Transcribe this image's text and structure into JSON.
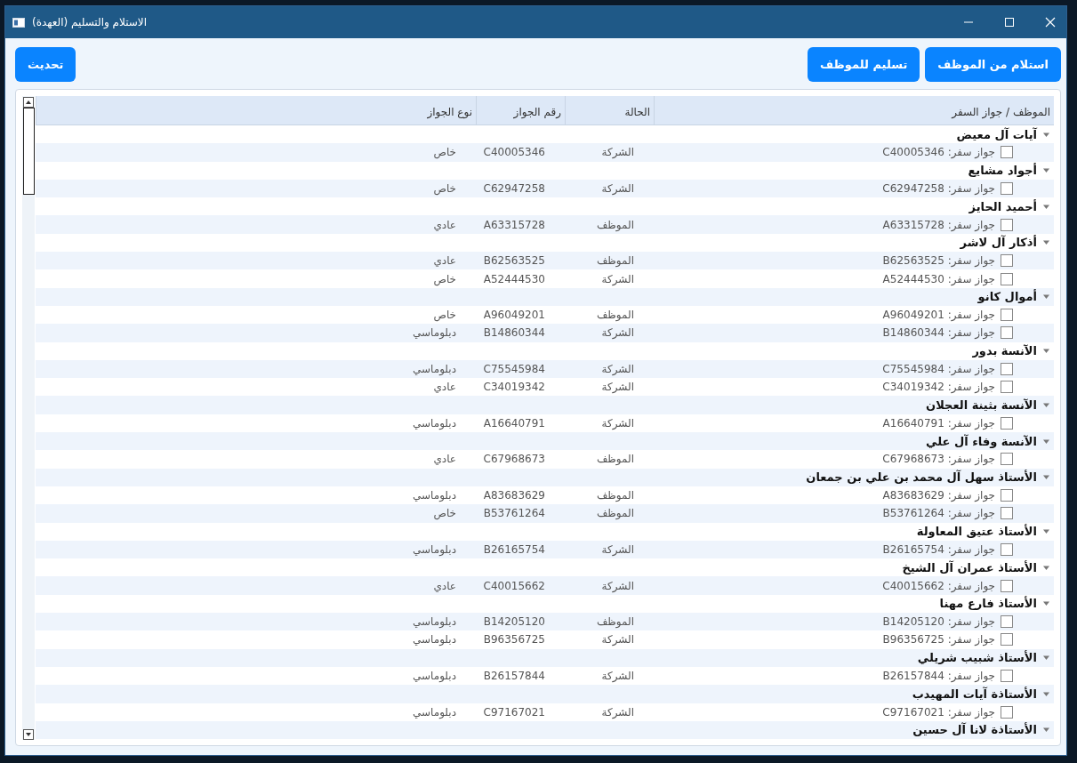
{
  "window": {
    "title": "الاستلام والتسليم (العهدة)"
  },
  "toolbar": {
    "refresh": "تحديث",
    "actions": [
      "استلام من الموظف",
      "تسليم للموظف"
    ]
  },
  "table": {
    "columns": [
      "الموظف / جواز السفر",
      "الحالة",
      "رقم الجواز",
      "نوع الجواز"
    ],
    "groups": [
      {
        "name": "آيات آل معيض",
        "expanded": true,
        "children": [
          {
            "label": "جواز سفر: C40005346",
            "checked": false,
            "status": "الشركة",
            "passport_no": "C40005346",
            "passport_type": "خاص"
          }
        ]
      },
      {
        "name": "أجواد مشايع",
        "expanded": true,
        "children": [
          {
            "label": "جواز سفر: C62947258",
            "checked": false,
            "status": "الشركة",
            "passport_no": "C62947258",
            "passport_type": "خاص"
          }
        ]
      },
      {
        "name": "أحميد الحايز",
        "expanded": true,
        "children": [
          {
            "label": "جواز سفر: A63315728",
            "checked": false,
            "status": "الموظف",
            "passport_no": "A63315728",
            "passport_type": "عادي"
          }
        ]
      },
      {
        "name": "أذكار آل لاشر",
        "expanded": true,
        "children": [
          {
            "label": "جواز سفر: B62563525",
            "checked": false,
            "status": "الموظف",
            "passport_no": "B62563525",
            "passport_type": "عادي"
          },
          {
            "label": "جواز سفر: A52444530",
            "checked": false,
            "status": "الشركة",
            "passport_no": "A52444530",
            "passport_type": "خاص"
          }
        ]
      },
      {
        "name": "أموال كانو",
        "expanded": true,
        "children": [
          {
            "label": "جواز سفر: A96049201",
            "checked": false,
            "status": "الموظف",
            "passport_no": "A96049201",
            "passport_type": "خاص"
          },
          {
            "label": "جواز سفر: B14860344",
            "checked": false,
            "status": "الشركة",
            "passport_no": "B14860344",
            "passport_type": "دبلوماسي"
          }
        ]
      },
      {
        "name": "الآنسة بدور",
        "expanded": true,
        "children": [
          {
            "label": "جواز سفر: C75545984",
            "checked": false,
            "status": "الشركة",
            "passport_no": "C75545984",
            "passport_type": "دبلوماسي"
          },
          {
            "label": "جواز سفر: C34019342",
            "checked": false,
            "status": "الشركة",
            "passport_no": "C34019342",
            "passport_type": "عادي"
          }
        ]
      },
      {
        "name": "الآنسة بثينة العجلان",
        "expanded": true,
        "children": [
          {
            "label": "جواز سفر: A16640791",
            "checked": false,
            "status": "الشركة",
            "passport_no": "A16640791",
            "passport_type": "دبلوماسي"
          }
        ]
      },
      {
        "name": "الآنسة وفاء آل علي",
        "expanded": true,
        "children": [
          {
            "label": "جواز سفر: C67968673",
            "checked": false,
            "status": "الموظف",
            "passport_no": "C67968673",
            "passport_type": "عادي"
          }
        ]
      },
      {
        "name": "الأستاذ سهل آل محمد بن علي بن جمعان",
        "expanded": true,
        "children": [
          {
            "label": "جواز سفر: A83683629",
            "checked": false,
            "status": "الموظف",
            "passport_no": "A83683629",
            "passport_type": "دبلوماسي"
          },
          {
            "label": "جواز سفر: B53761264",
            "checked": false,
            "status": "الموظف",
            "passport_no": "B53761264",
            "passport_type": "خاص"
          }
        ]
      },
      {
        "name": "الأستاذ عتيق المعاولة",
        "expanded": true,
        "children": [
          {
            "label": "جواز سفر: B26165754",
            "checked": false,
            "status": "الشركة",
            "passport_no": "B26165754",
            "passport_type": "دبلوماسي"
          }
        ]
      },
      {
        "name": "الأستاذ عمران آل الشيخ",
        "expanded": true,
        "children": [
          {
            "label": "جواز سفر: C40015662",
            "checked": false,
            "status": "الشركة",
            "passport_no": "C40015662",
            "passport_type": "عادي"
          }
        ]
      },
      {
        "name": "الأستاذ فارع مهنا",
        "expanded": true,
        "children": [
          {
            "label": "جواز سفر: B14205120",
            "checked": false,
            "status": "الموظف",
            "passport_no": "B14205120",
            "passport_type": "دبلوماسي"
          },
          {
            "label": "جواز سفر: B96356725",
            "checked": false,
            "status": "الشركة",
            "passport_no": "B96356725",
            "passport_type": "دبلوماسي"
          }
        ]
      },
      {
        "name": "الأستاذ شبيب شريلي",
        "expanded": true,
        "children": [
          {
            "label": "جواز سفر: B26157844",
            "checked": false,
            "status": "الشركة",
            "passport_no": "B26157844",
            "passport_type": "دبلوماسي"
          }
        ]
      },
      {
        "name": "الأستاذة آيات المهيدب",
        "expanded": true,
        "children": [
          {
            "label": "جواز سفر: C97167021",
            "checked": false,
            "status": "الشركة",
            "passport_no": "C97167021",
            "passport_type": "دبلوماسي"
          }
        ]
      },
      {
        "name": "الأستاذة لانا آل حسين",
        "expanded": true
      }
    ]
  }
}
